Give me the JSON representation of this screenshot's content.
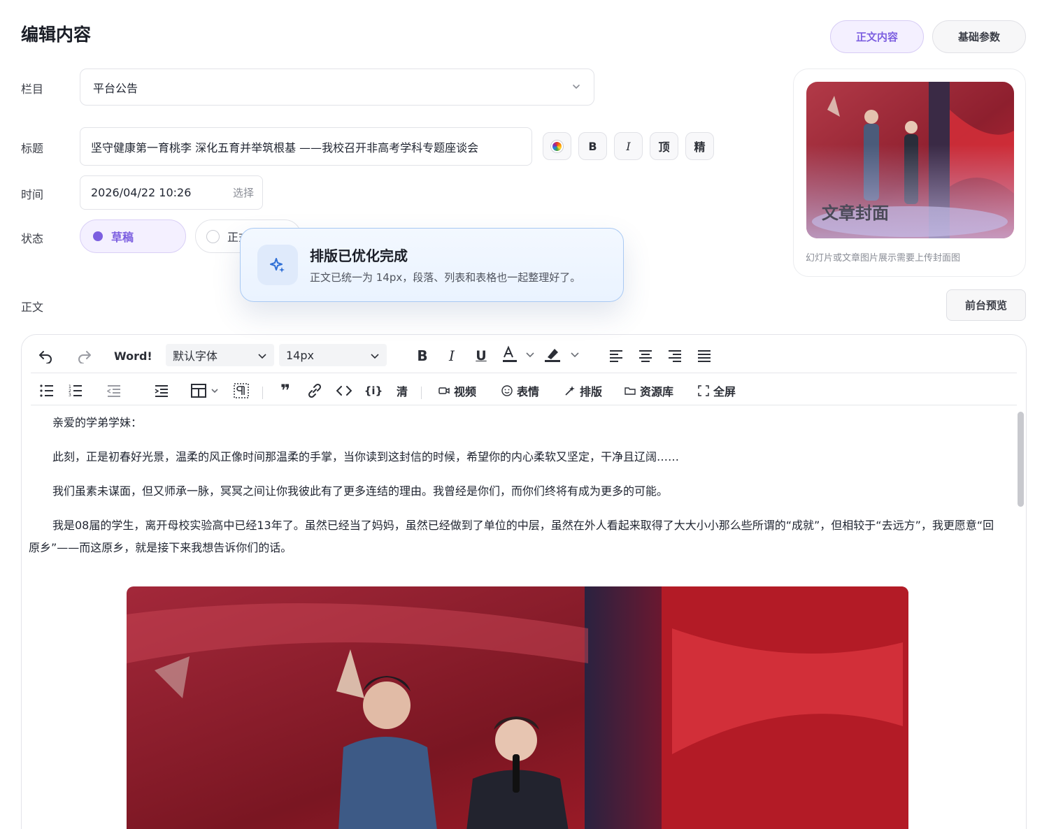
{
  "header": {
    "title": "编辑内容"
  },
  "tabs": [
    {
      "label": "正文内容",
      "active": true
    },
    {
      "label": "基础参数",
      "active": false
    }
  ],
  "form": {
    "category_label": "栏目",
    "category_value": "平台公告",
    "title_label": "标题",
    "title_value": "坚守健康第一育桃李 深化五育并举筑根基 ——我校召开非高考学科专题座谈会",
    "title_buttons": {
      "bold": "B",
      "italic": "I",
      "top": "顶",
      "featured": "精"
    },
    "time_label": "时间",
    "time_value": "2026/04/22 10:26",
    "time_pick": "选择",
    "status_label": "状态",
    "status_draft": "草稿",
    "status_formal": "正式",
    "body_label": "正文"
  },
  "toast": {
    "title": "排版已优化完成",
    "desc": "正文已统一为 14px，段落、列表和表格也一起整理好了。"
  },
  "cover": {
    "label": "文章封面",
    "hint": "幻灯片或文章图片展示需要上传封面图"
  },
  "preview_button": "前台预览",
  "editor": {
    "word_label": "Word!",
    "font_family": "默认字体",
    "font_size": "14px",
    "clear_label": "清",
    "video_label": "视频",
    "emoji_label": "表情",
    "layout_label": "排版",
    "library_label": "资源库",
    "fullscreen_label": "全屏",
    "paragraphs": [
      "亲爱的学弟学妹：",
      "此刻，正是初春好光景，温柔的风正像时间那温柔的手掌，当你读到这封信的时候，希望你的内心柔软又坚定，干净且辽阔……",
      "我们虽素未谋面，但又师承一脉，冥冥之间让你我彼此有了更多连结的理由。我曾经是你们，而你们终将有成为更多的可能。",
      "我是08届的学生，离开母校实验高中已经13年了。虽然已经当了妈妈，虽然已经做到了单位的中层，虽然在外人看起来取得了大大小小那么些所谓的“成就”，但相较于“去远方”，我更愿意“回原乡”——而这原乡，就是接下来我想告诉你们的话。"
    ]
  },
  "colors": {
    "accent": "#7c5fe0",
    "toast_border": "#a9c9f3"
  }
}
